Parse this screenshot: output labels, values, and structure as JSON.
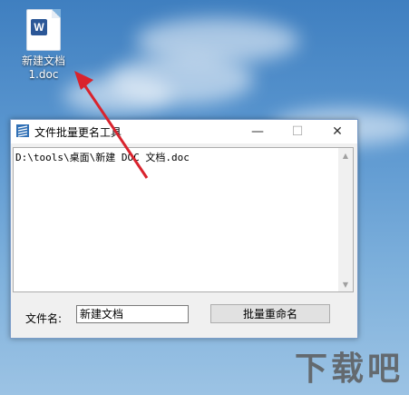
{
  "desktop": {
    "file_icon": {
      "badge": "W",
      "label_line1": "新建文档",
      "label_line2": "1.doc"
    }
  },
  "window": {
    "title": "文件批量更名工具",
    "controls": {
      "minimize": "—",
      "maximize": "☐",
      "close": "✕"
    },
    "file_list_text": "D:\\tools\\桌面\\新建 DOC 文档.doc",
    "filename_label": "文件名:",
    "filename_value": "新建文档",
    "rename_button": "批量重命名"
  },
  "watermark": "下载吧",
  "colors": {
    "accent": "#2b5797",
    "annotation_arrow": "#d9232d"
  }
}
